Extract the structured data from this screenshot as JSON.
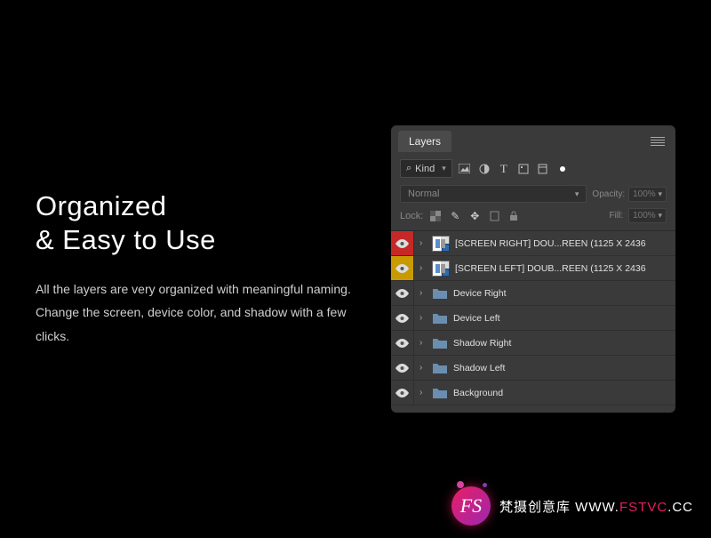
{
  "headline": {
    "line1": "Organized",
    "line2": "& Easy to Use"
  },
  "description": "All the layers are very organized with meaningful naming. Change the screen, device color, and shadow with a few clicks.",
  "panel": {
    "tab": "Layers",
    "filter": {
      "kind": "Kind"
    },
    "blend": {
      "mode": "Normal",
      "opacityLabel": "Opacity:",
      "opacityValue": "100%"
    },
    "lock": {
      "label": "Lock:",
      "fillLabel": "Fill:",
      "fillValue": "100%"
    },
    "layers": [
      {
        "name": "[SCREEN RIGHT] DOU...REEN (1125 X 2436",
        "type": "smart",
        "color": "red"
      },
      {
        "name": "[SCREEN LEFT] DOUB...REEN (1125 X 2436",
        "type": "smart",
        "color": "yellow"
      },
      {
        "name": "Device Right",
        "type": "folder"
      },
      {
        "name": "Device Left",
        "type": "folder"
      },
      {
        "name": "Shadow Right",
        "type": "folder"
      },
      {
        "name": "Shadow Left",
        "type": "folder"
      },
      {
        "name": "Background",
        "type": "folder"
      }
    ]
  },
  "watermark": {
    "badge": "FS",
    "brand": "梵摄创意库",
    "url_prefix": "WWW.",
    "url_mid": "FSTVC",
    "url_suffix": ".CC"
  }
}
